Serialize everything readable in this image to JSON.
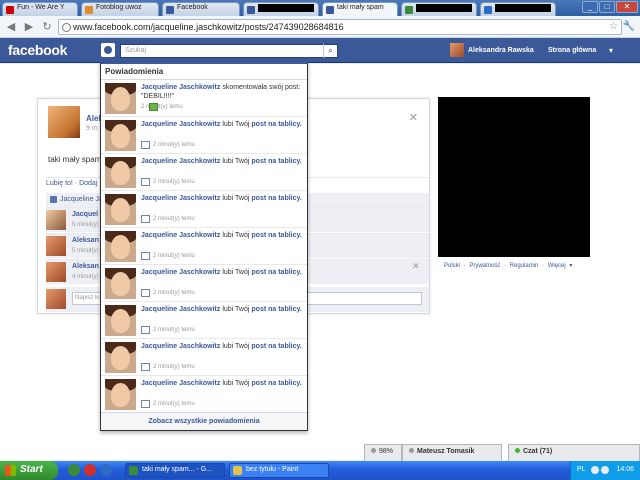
{
  "browser": {
    "tabs": [
      {
        "label": "Fun - We Are Y",
        "favicon_color": "#cc0000"
      },
      {
        "label": "Fotoblog uwoz",
        "favicon_color": "#e08a2a"
      },
      {
        "label": "Facebook",
        "favicon_color": "#3b5998"
      },
      {
        "label": "",
        "favicon_color": "#3b5998",
        "redacted": true
      },
      {
        "label": "taki mały spam",
        "favicon_color": "#3b5998"
      },
      {
        "label": "",
        "favicon_color": "#3a8a3a",
        "redacted": true
      },
      {
        "label": "",
        "favicon_color": "#2b6cc4",
        "redacted": true
      }
    ],
    "url": "www.facebook.com/jacqueline.jaschkowitz/posts/247439028684816"
  },
  "facebook": {
    "logo": "facebook",
    "search_placeholder": "Szukaj",
    "user_name": "Aleksandra Rawska",
    "home_label": "Strona główna"
  },
  "post": {
    "author_partial": "Alel",
    "time_partial": "9 m",
    "text": "taki mały spam",
    "actions": "Lubię to! · Dodaj",
    "likes": "Jacqueline Jasch",
    "comments": [
      {
        "name": "Jacquel",
        "time": "5 minut(y)"
      },
      {
        "name": "Aleksan",
        "time": "5 minut(y)"
      },
      {
        "name": "Aleksan",
        "time": "4 minut(y)"
      }
    ],
    "write_placeholder": "Napisz kom"
  },
  "right_column": {
    "footer_links": "Polski · Prywatność · Regulamin · Więcej ▾"
  },
  "notifications": {
    "header": "Powiadomienia",
    "footer": "Zobacz wszystkie powiadomienia",
    "items": [
      {
        "actor": "Jacqueline Jaschkowitz",
        "action": "skomentowała swój post: \"DEBIL!!!!\"",
        "link": "",
        "time": "2 minut(y) temu",
        "type": "comment"
      },
      {
        "actor": "Jacqueline Jaschkowitz",
        "action": "lubi Twój",
        "link": "post na tablicy.",
        "time": "2 minut(y) temu",
        "type": "like"
      },
      {
        "actor": "Jacqueline Jaschkowitz",
        "action": "lubi Twój",
        "link": "post na tablicy.",
        "time": "2 minut(y) temu",
        "type": "like"
      },
      {
        "actor": "Jacqueline Jaschkowitz",
        "action": "lubi Twój",
        "link": "post na tablicy.",
        "time": "2 minut(y) temu",
        "type": "like"
      },
      {
        "actor": "Jacqueline Jaschkowitz",
        "action": "lubi Twój",
        "link": "post na tablicy.",
        "time": "2 minut(y) temu",
        "type": "like"
      },
      {
        "actor": "Jacqueline Jaschkowitz",
        "action": "lubi Twój",
        "link": "post na tablicy.",
        "time": "2 minut(y) temu",
        "type": "like"
      },
      {
        "actor": "Jacqueline Jaschkowitz",
        "action": "lubi Twój",
        "link": "post na tablicy.",
        "time": "2 minut(y) temu",
        "type": "like"
      },
      {
        "actor": "Jacqueline Jaschkowitz",
        "action": "lubi Twój",
        "link": "post na tablicy.",
        "time": "2 minut(y) temu",
        "type": "like"
      },
      {
        "actor": "Jacqueline Jaschkowitz",
        "action": "lubi Twój",
        "link": "post na tablicy.",
        "time": "2 minut(y) temu",
        "type": "like"
      }
    ]
  },
  "chat_dock": {
    "battery": "98%",
    "contact": "Mateusz Tomasik",
    "chat": "Czat (71)"
  },
  "taskbar": {
    "start": "Start",
    "tasks": [
      {
        "label": "taki mały spam... - G..."
      },
      {
        "label": "bez tytułu - Paint"
      }
    ],
    "lang": "PL",
    "clock": "14:06"
  },
  "colors": {
    "facebook_blue": "#3b5998",
    "link": "#3b5998"
  }
}
